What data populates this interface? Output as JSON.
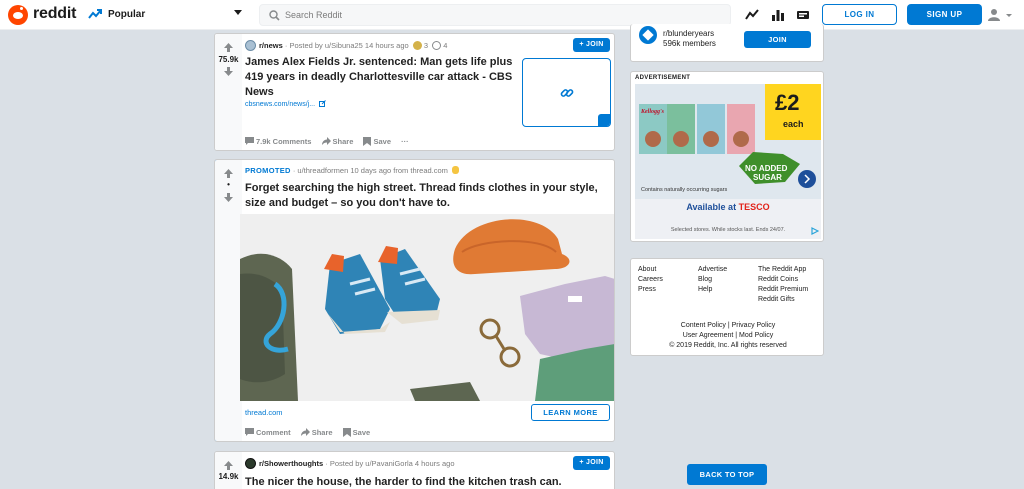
{
  "header": {
    "brand": "reddit",
    "feed": "Popular",
    "search_placeholder": "Search Reddit",
    "login": "LOG IN",
    "signup": "SIGN UP"
  },
  "posts": [
    {
      "votes": "75.9k",
      "community": "r/news",
      "posted_by": "· Posted by u/Sibuna25 14 hours ago",
      "award_counts": [
        "3",
        "4"
      ],
      "join": "+ JOIN",
      "title": "James Alex Fields Jr. sentenced: Man gets life plus 419 years in deadly Charlottesville car attack - CBS News",
      "link": "cbsnews.com/news/j...",
      "actions": [
        "7.9k Comments",
        "Share",
        "Save",
        "···"
      ]
    },
    {
      "votes": "•",
      "promoted_label": "PROMOTED",
      "posted_by": "· u/threadformen 10 days ago from thread.com",
      "title": "Forget searching the high street. Thread finds clothes in your style, size and budget – so you don't have to.",
      "link": "thread.com",
      "cta": "LEARN MORE",
      "actions": [
        "Comment",
        "Share",
        "Save"
      ]
    },
    {
      "votes": "14.9k",
      "community": "r/Showerthoughts",
      "posted_by": "· Posted by u/PavaniGorla 4 hours ago",
      "join": "+ JOIN",
      "title": "The nicer the house, the harder to find the kitchen trash can."
    }
  ],
  "sidebar": {
    "community": {
      "name": "r/blunderyears",
      "members": "596k members",
      "join": "JOIN"
    },
    "ad": {
      "heading": "ADVERTISEMENT",
      "price": "£2",
      "price_unit": "each",
      "badge_line1": "NO ADDED",
      "badge_line2": "SUGAR",
      "note": "Contains naturally occurring sugars",
      "available": "Available at",
      "store": "TESCO",
      "fine_print": "Selected stores. While stocks last. Ends 24/07.",
      "product_brand": "Kellogg's"
    },
    "footer": {
      "col1": [
        "About",
        "Careers",
        "Press"
      ],
      "col2": [
        "Advertise",
        "Blog",
        "Help"
      ],
      "col3": [
        "The Reddit App",
        "Reddit Coins",
        "Reddit Premium",
        "Reddit Gifts"
      ],
      "line1": "Content Policy |  Privacy Policy",
      "line2": "User Agreement |  Mod Policy",
      "copyright": "© 2019 Reddit, Inc. All rights reserved"
    }
  },
  "back_to_top": "BACK TO TOP",
  "colors": {
    "brand": "#ff4500",
    "accent": "#0079d3",
    "background": "#dae0e6"
  }
}
